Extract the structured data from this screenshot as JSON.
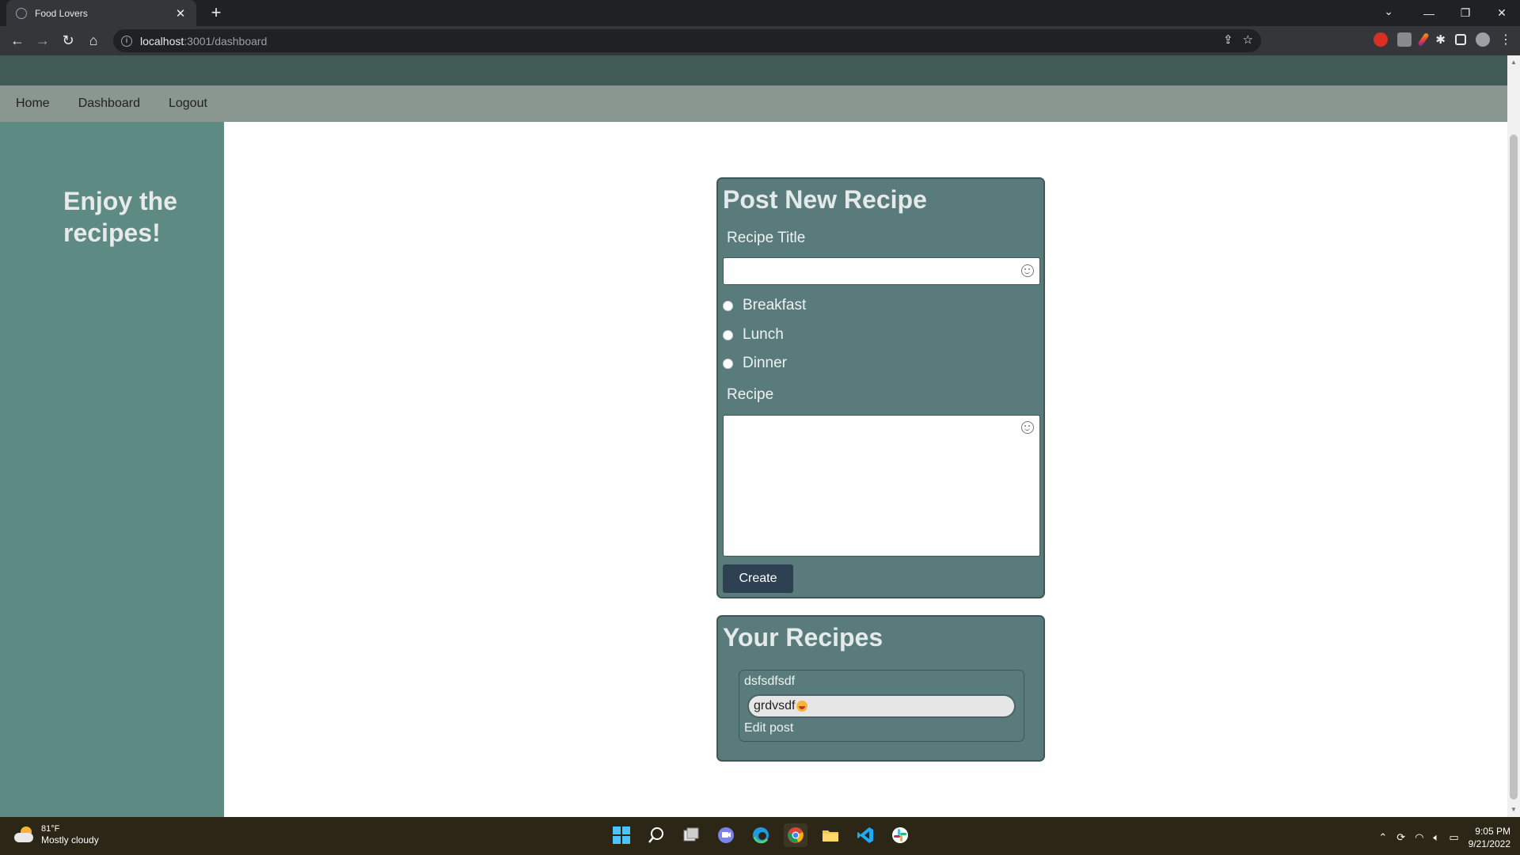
{
  "browser": {
    "tab_title": "Food Lovers",
    "url_host": "localhost",
    "url_path": ":3001/dashboard"
  },
  "nav": {
    "home": "Home",
    "dashboard": "Dashboard",
    "logout": "Logout"
  },
  "sidebar": {
    "tagline": "Enjoy the recipes!"
  },
  "new_recipe_form": {
    "heading": "Post New Recipe",
    "title_label": "Recipe Title",
    "title_value": "",
    "meal_options": [
      "Breakfast",
      "Lunch",
      "Dinner"
    ],
    "recipe_label": "Recipe",
    "recipe_value": "",
    "create_label": "Create"
  },
  "your_recipes": {
    "heading": "Your Recipes",
    "items": [
      {
        "title": "dsfsdfsdf",
        "body": "grdvsdf",
        "edit_label": "Edit post"
      }
    ]
  },
  "taskbar": {
    "weather_temp": "81°F",
    "weather_desc": "Mostly cloudy",
    "time": "9:05 PM",
    "date": "9/21/2022"
  },
  "colors": {
    "hero_band": "#405a56",
    "navbar": "#8a9690",
    "sidebar": "#5e8a84",
    "card": "#5a7b7b",
    "button": "#2e4152"
  }
}
